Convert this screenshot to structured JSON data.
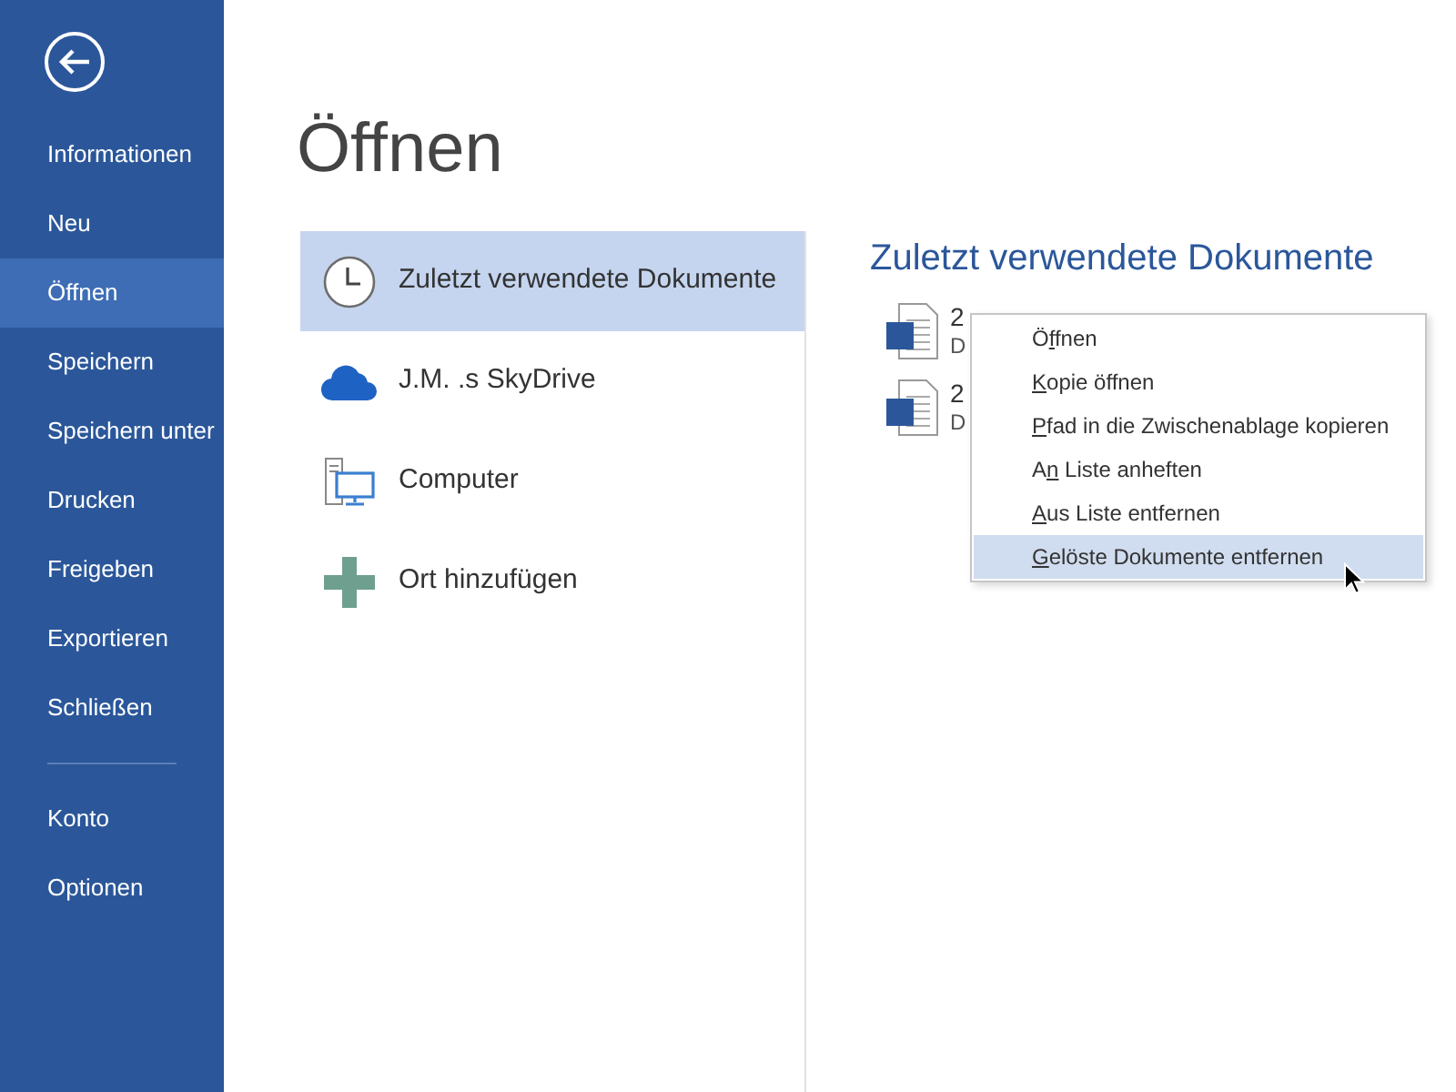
{
  "sidebar": {
    "items": [
      {
        "label": "Informationen",
        "selected": false
      },
      {
        "label": "Neu",
        "selected": false
      },
      {
        "label": "Öffnen",
        "selected": true
      },
      {
        "label": "Speichern",
        "selected": false
      },
      {
        "label": "Speichern unter",
        "selected": false
      },
      {
        "label": "Drucken",
        "selected": false
      },
      {
        "label": "Freigeben",
        "selected": false
      },
      {
        "label": "Exportieren",
        "selected": false
      },
      {
        "label": "Schließen",
        "selected": false
      }
    ],
    "footer_items": [
      {
        "label": "Konto",
        "selected": false
      },
      {
        "label": "Optionen",
        "selected": false
      }
    ]
  },
  "page_title": "Öffnen",
  "places": [
    {
      "kind": "recent",
      "label": "Zuletzt verwendete Dokumente",
      "selected": true
    },
    {
      "kind": "cloud",
      "label": "J.M. .s SkyDrive",
      "selected": false
    },
    {
      "kind": "computer",
      "label": "Computer",
      "selected": false
    },
    {
      "kind": "add",
      "label": "Ort hinzufügen",
      "selected": false
    }
  ],
  "recent": {
    "heading": "Zuletzt verwendete Dokumente",
    "documents": [
      {
        "name": "2",
        "path": "D"
      },
      {
        "name": "2",
        "path": "D"
      }
    ]
  },
  "context_menu": {
    "items": [
      {
        "prefix": "Ö",
        "key": "f",
        "suffix": "fnen",
        "selected": false
      },
      {
        "key": "K",
        "suffix": "opie öffnen",
        "selected": false
      },
      {
        "key": "P",
        "suffix": "fad in die Zwischenablage kopieren",
        "selected": false
      },
      {
        "prefix": "A",
        "key": "n",
        "suffix": " Liste anheften",
        "selected": false
      },
      {
        "key": "A",
        "suffix": "us Liste entfernen",
        "selected": false
      },
      {
        "key": "G",
        "suffix": "elöste Dokumente entfernen",
        "selected": true
      }
    ]
  }
}
